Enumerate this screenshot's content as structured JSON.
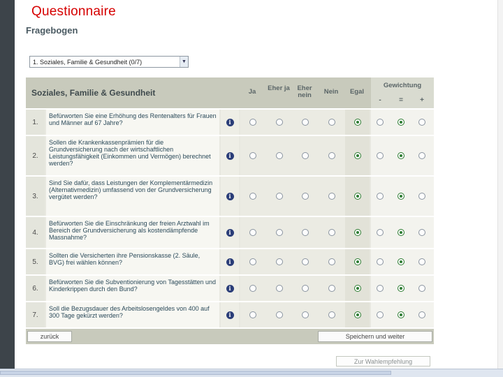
{
  "slide": {
    "title": "Questionnaire"
  },
  "form": {
    "title": "Fragebogen"
  },
  "section_select": {
    "value": "1.  Soziales, Familie & Gesundheit (0/7)"
  },
  "table": {
    "section_title": "Soziales, Familie & Gesundheit",
    "columns": [
      "Ja",
      "Eher ja",
      "Eher nein",
      "Nein",
      "Egal"
    ],
    "weight_header": "Gewichtung",
    "weight_symbols": [
      "-",
      "=",
      "+"
    ],
    "rows": [
      {
        "num": "1.",
        "text": "Befürworten Sie eine Erhöhung des Rentenalters für Frauen und Männer auf 67 Jahre?",
        "answer": "Egal",
        "weight": "="
      },
      {
        "num": "2.",
        "text": "Sollen die Krankenkassenprämien für die Grundversicherung nach der wirtschaftlichen Leistungsfähigkeit (Einkommen und Vermögen) berechnet werden?",
        "answer": "Egal",
        "weight": "="
      },
      {
        "num": "3.",
        "text": "Sind Sie dafür, dass Leistungen der Komplementärmedizin (Alternativmedizin) umfassend von der Grundversicherung vergütet werden?",
        "answer": "Egal",
        "weight": "="
      },
      {
        "num": "4.",
        "text": "Befürworten Sie die Einschränkung der freien Arztwahl im Bereich der Grundversicherung als kostendämpfende Massnahme?",
        "answer": "Egal",
        "weight": "="
      },
      {
        "num": "5.",
        "text": "Sollten die Versicherten ihre Pensionskasse (2. Säule, BVG) frei wählen können?",
        "answer": "Egal",
        "weight": "="
      },
      {
        "num": "6.",
        "text": "Befürworten Sie die Subventionierung von Tagesstätten und Kinderkrippen durch den Bund?",
        "answer": "Egal",
        "weight": "="
      },
      {
        "num": "7.",
        "text": "Soll die Bezugsdauer des Arbeitslosengeldes von 400 auf 300 Tage gekürzt werden?",
        "answer": "Egal",
        "weight": "="
      }
    ]
  },
  "buttons": {
    "back": "zurück",
    "save_next": "Speichern und weiter",
    "voting_advice": "Zur Wahlempfehlung"
  },
  "colors": {
    "title_red": "#d60000",
    "header_bg": "#c8cabc",
    "selected_green": "#2e7d33",
    "info_blue": "#2a3d78"
  },
  "icons": {
    "info": "info-icon",
    "dropdown": "chevron-down-icon"
  }
}
